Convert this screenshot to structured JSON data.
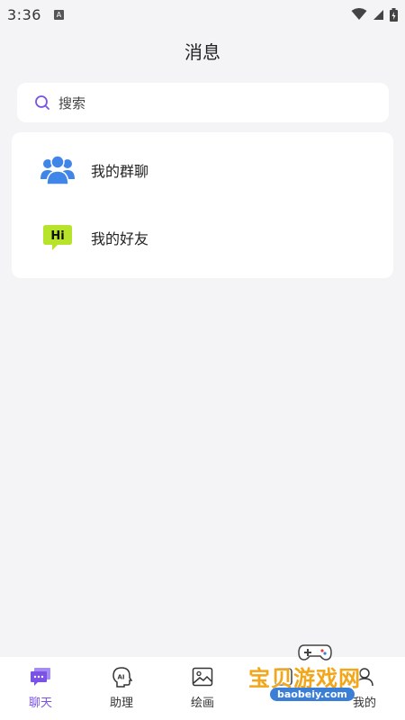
{
  "status_bar": {
    "time": "3:36",
    "notification_badge": "A"
  },
  "header": {
    "title": "消息"
  },
  "search": {
    "placeholder": "搜索"
  },
  "list": {
    "items": [
      {
        "label": "我的群聊",
        "icon": "group-chat-icon"
      },
      {
        "label": "我的好友",
        "icon": "friends-hi-icon",
        "icon_text": "Hi"
      }
    ]
  },
  "tabs": [
    {
      "label": "聊天",
      "icon": "chat-icon",
      "active": true
    },
    {
      "label": "助理",
      "icon": "ai-assistant-icon",
      "icon_text": "AI"
    },
    {
      "label": "绘画",
      "icon": "image-icon"
    },
    {
      "label": "",
      "icon": "plaza-icon"
    },
    {
      "label": "我的",
      "icon": "profile-icon"
    }
  ],
  "watermark": {
    "text": "宝贝游戏网",
    "url": "baobeiy.com"
  },
  "colors": {
    "accent": "#7a52e6",
    "background": "#f4f4f7",
    "group_icon": "#3f86e8",
    "hi_icon": "#b7e32a",
    "watermark": "#f2a61a"
  }
}
